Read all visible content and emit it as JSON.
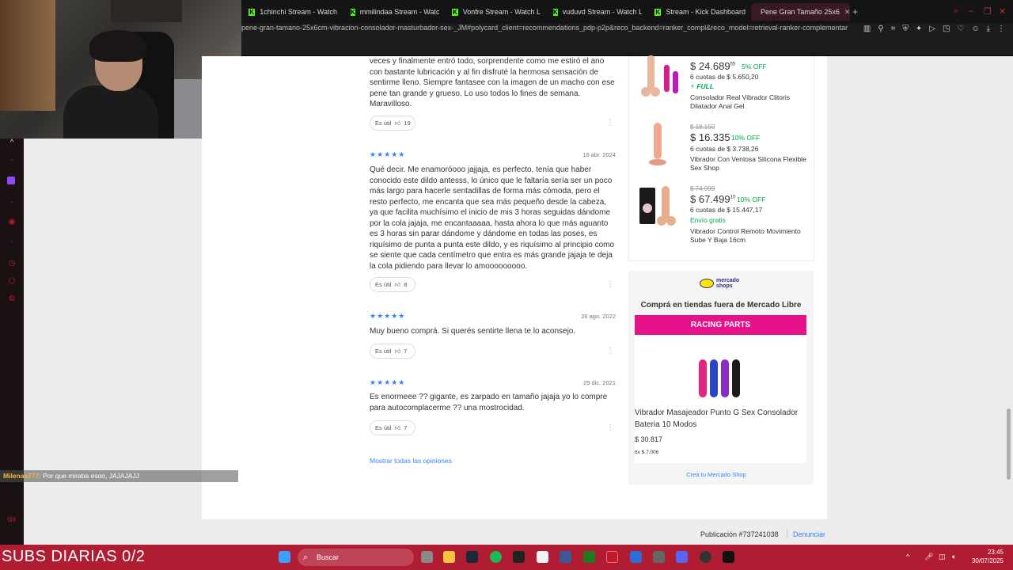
{
  "browser": {
    "tabs": [
      {
        "label": "1chinchi Stream - Watch"
      },
      {
        "label": "mmilindaa Stream - Watc"
      },
      {
        "label": "Vonfre Stream - Watch L"
      },
      {
        "label": "vuduvd Stream - Watch L"
      },
      {
        "label": "Stream - Kick Dashboard"
      },
      {
        "label": "Pene Gran Tamaño 25x6"
      }
    ],
    "new_tab": "+",
    "url": "pene-gran-tamano-25x6cm-vibracion-consolador-masturbador-sex-_JM#polycard_client=recommendations_pdp-p2p&reco_backend=ranker_compl&reco_model=retrieval-ranker-complementar"
  },
  "reviews": [
    {
      "text": "veces y finalmente entró todo, sorprendente como me estiró el ano con bastante lubricación y al fin disfruté la hermosa sensación de sentirme lleno. Siempre fantasee con la imagen de un macho con ese pene tan grande y grueso. Lo uso todos lo fines de semana. Maravilloso.",
      "useful_label": "Es útil",
      "useful_count": "19"
    },
    {
      "stars": "★★★★★",
      "date": "16 abr. 2024",
      "text": "Qué decir. Me enamoróooo jajjaja, es perfecto, tenía que haber conocido este dildo antesss, lo único que le faltaría sería ser un poco más largo para hacerle sentadillas de forma más cómoda, pero el resto perfecto, me encanta que sea más pequeño desde la cabeza, ya que facilita muchísimo el inicio de mis 3 horas seguidas dándome por la cola jajaja, me encantaaaaa, hasta ahora lo que más aguanto es 3 horas sin parar dándome y dándome en todas las poses, es riquísimo de punta a punta este dildo, y es riquísimo al principio como se siente que cada centímetro que entra es más grande jajaja te deja la cola pidiendo para llevar lo amooooooooo.",
      "useful_label": "Es útil",
      "useful_count": "8"
    },
    {
      "stars": "★★★★★",
      "date": "26 ago. 2022",
      "text": "Muy bueno comprá. Si querés sentirte llena te lo aconsejo.",
      "useful_label": "Es útil",
      "useful_count": "7"
    },
    {
      "stars": "★★★★★",
      "date": "29 dic. 2021",
      "text": "Es enormeee ?? gigante, es zarpado en tamaño jajaja yo lo compre para autocomplacerme ?? una mostrocidad.",
      "useful_label": "Es útil",
      "useful_count": "7"
    }
  ],
  "see_all": "Mostrar todas las opiniones",
  "recommendations": [
    {
      "price": "$ 24.689",
      "price_cents": "55",
      "off": "5% OFF",
      "installments": "6 cuotas de $ 5.650,20",
      "shipping": "⚡ FULL",
      "title": "Consolador Real Vibrador Clitoris Dilatador Anal Gel"
    },
    {
      "old_price": "$ 18.150",
      "price": "$ 16.335",
      "off": "10% OFF",
      "installments": "6 cuotas de $ 3.738,26",
      "title": "Vibrador Con Ventosa Silicona Flexible Sex Shop"
    },
    {
      "old_price": "$ 74.999",
      "price": "$ 67.499",
      "price_cents": "10",
      "off": "10% OFF",
      "installments": "6 cuotas de $ 15.447,17",
      "shipping": "Envío gratis",
      "title": "Vibrador Control Remoto Movimiento Sube Y Baja 16cm"
    }
  ],
  "shops": {
    "logo_line1": "mercado",
    "logo_line2": "shops",
    "heading": "Comprá en tiendas fuera de Mercado Libre",
    "banner": "RACING PARTS",
    "product_title": "Vibrador Masajeador Punto G Sex Consolador Bateria 10 Modos",
    "price": "$ 30.817",
    "installments": "6x $ 7.006",
    "create_link": "Creá tu Mercado Shop"
  },
  "footer": {
    "publication": "Publicación #737241038",
    "report": "Denunciar"
  },
  "chat": {
    "user": "Milenaa777",
    "separator": ":",
    "message": "Por que miraba esoo, JAJAJAJJ"
  },
  "overlay": {
    "subs": "SUBS DIARIAS 0/2"
  },
  "taskbar": {
    "search": "Buscar",
    "time": "23:45",
    "date": "30/07/2025"
  },
  "colors": {
    "accent": "#3483fa",
    "kick": "#53fc18",
    "shops_banner": "#e5128a",
    "taskbar": "#b01c32",
    "discount": "#00a650"
  }
}
